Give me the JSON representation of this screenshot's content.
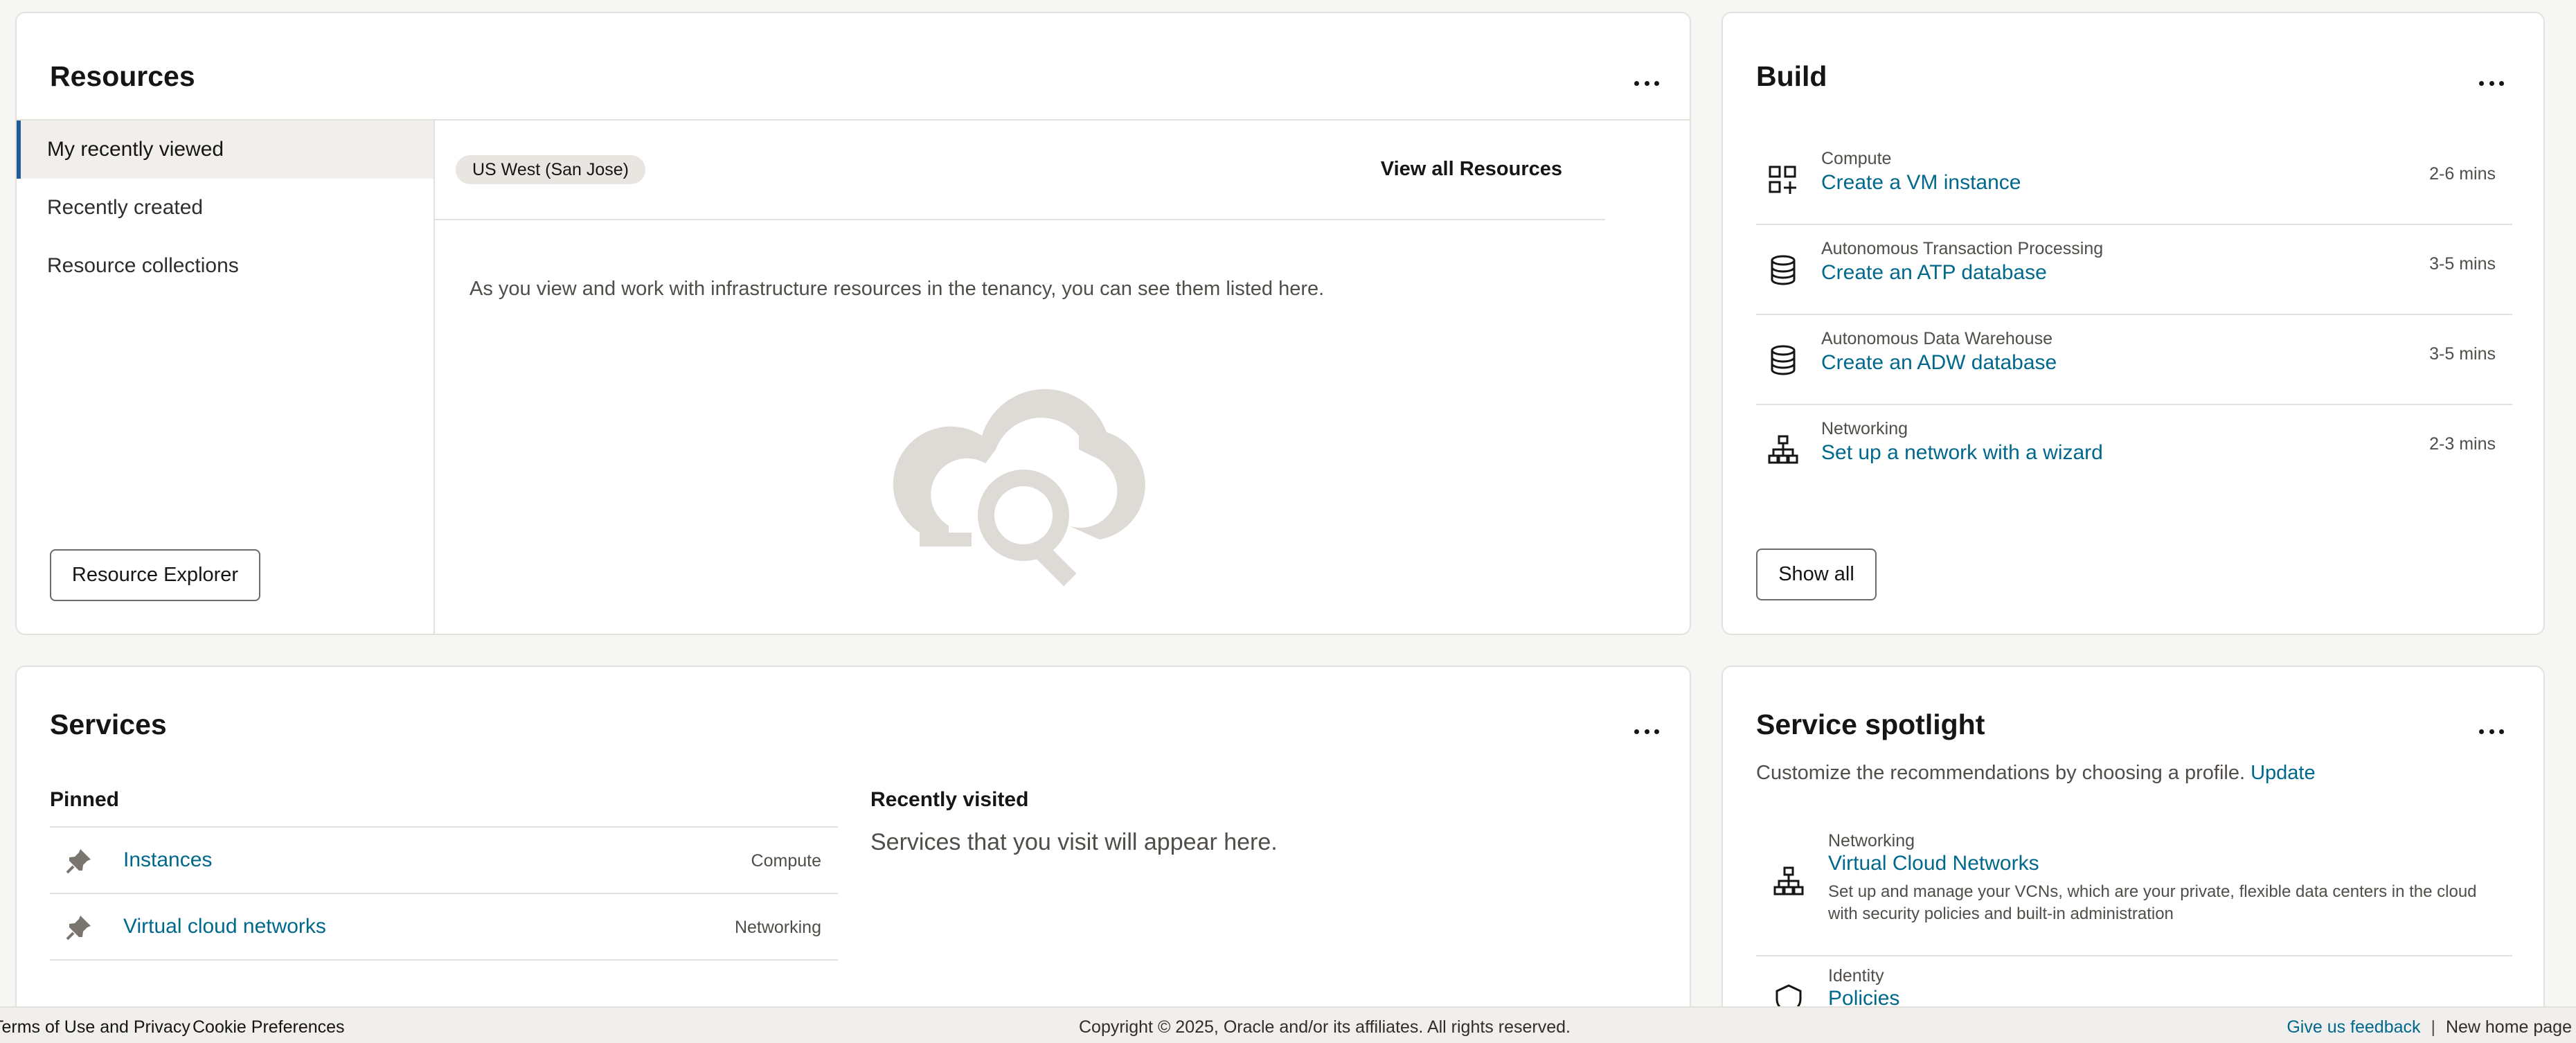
{
  "resources": {
    "title": "Resources",
    "more_label": "More actions",
    "tabs": [
      {
        "label": "My recently viewed",
        "active": true
      },
      {
        "label": "Recently created",
        "active": false
      },
      {
        "label": "Resource collections",
        "active": false
      }
    ],
    "explorer_button": "Resource Explorer",
    "region_chip": "US West (San Jose)",
    "view_all": "View all Resources",
    "empty_message": "As you view and work with infrastructure resources in the tenancy, you can see them listed here."
  },
  "build": {
    "title": "Build",
    "items": [
      {
        "category": "Compute",
        "link": "Create a VM instance",
        "time": "2-6 mins",
        "icon": "grid-plus-icon"
      },
      {
        "category": "Autonomous Transaction Processing",
        "link": "Create an ATP database",
        "time": "3-5 mins",
        "icon": "database-icon"
      },
      {
        "category": "Autonomous Data Warehouse",
        "link": "Create an ADW database",
        "time": "3-5 mins",
        "icon": "database-icon"
      },
      {
        "category": "Networking",
        "link": "Set up a network with a wizard",
        "time": "2-3 mins",
        "icon": "network-icon"
      }
    ],
    "show_all": "Show all"
  },
  "services": {
    "title": "Services",
    "pinned_heading": "Pinned",
    "pinned": [
      {
        "label": "Instances",
        "category": "Compute",
        "icon": "pin-icon"
      },
      {
        "label": "Virtual cloud networks",
        "category": "Networking",
        "icon": "pin-icon"
      }
    ],
    "recent_heading": "Recently visited",
    "recent_empty": "Services that you visit will appear here."
  },
  "spotlight": {
    "title": "Service spotlight",
    "description": "Customize the recommendations by choosing a profile.",
    "update_link": "Update",
    "items": [
      {
        "category": "Networking",
        "link": "Virtual Cloud Networks",
        "description": "Set up and manage your VCNs, which are your private, flexible data centers in the cloud with security policies and built-in administration",
        "icon": "network-icon"
      },
      {
        "category": "Identity",
        "link": "Policies",
        "description": "",
        "icon": "shield-icon"
      }
    ]
  },
  "footer": {
    "terms": "Terms of Use and Privacy",
    "cookie": "Cookie Preferences",
    "copyright": "Copyright © 2025, Oracle and/or its affiliates. All rights reserved.",
    "feedback": "Give us feedback",
    "separator": "|",
    "new_home": "New home page"
  },
  "colors": {
    "link": "#00688c",
    "active_tab_border": "#1f5c99",
    "illustration": "#dedbd7"
  }
}
